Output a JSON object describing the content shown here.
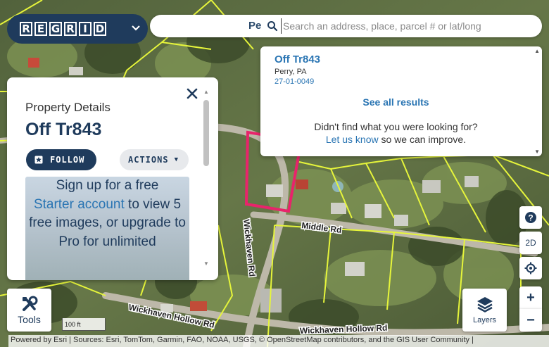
{
  "brand": {
    "letters": [
      "R",
      "E",
      "G",
      "R",
      "I",
      "D"
    ],
    "color": "#1f3b5c"
  },
  "search": {
    "context": "Pe",
    "placeholder": "Search an address, place, parcel # or lat/long"
  },
  "results": {
    "items": [
      {
        "title": "Off Tr843",
        "city": "Perry, PA",
        "parcel": "27-01-0049"
      }
    ],
    "see_all": "See all results",
    "not_found": "Didn't find what you were looking for?",
    "let_us_know": "Let us know",
    "improve": " so we can improve."
  },
  "panel": {
    "heading": "Property Details",
    "title": "Off Tr843",
    "follow_label": "FOLLOW",
    "actions_label": "ACTIONS",
    "promo": {
      "line1": "Sign up for a free",
      "link": "Starter account",
      "line2": " to view 5 free images, or upgrade to Pro for unlimited"
    }
  },
  "map": {
    "roads": [
      "Middle Rd",
      "Wickhaven Rd",
      "Wickhaven Hollow Rd",
      "Wickhaven Hollow Rd"
    ],
    "scale": "100 ft",
    "selected_parcel_color": "#e8246b",
    "parcel_line_color": "#e6f53b"
  },
  "controls": {
    "help": "?",
    "toggle_2d": "2D",
    "zoom_in": "+",
    "zoom_out": "−",
    "tools_label": "Tools",
    "layers_label": "Layers"
  },
  "attribution": "Powered by Esri | Sources: Esri, TomTom, Garmin, FAO, NOAA, USGS, © OpenStreetMap contributors, and the GIS User Community |",
  "colors": {
    "accent": "#2a75b3",
    "navy": "#1f3b5c"
  }
}
